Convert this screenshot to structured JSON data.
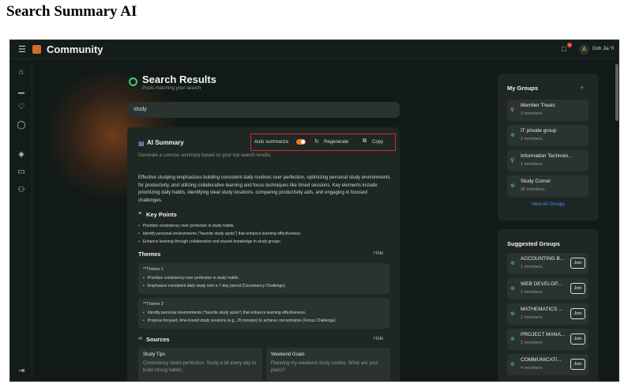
{
  "page_heading": "Search Summary AI",
  "header": {
    "brand": "Community",
    "notifications_count": "1",
    "user_name": "Goh Jia Yi",
    "user_initial": "A"
  },
  "search": {
    "title": "Search Results",
    "subtitle": "Posts matching your search",
    "query": "study"
  },
  "ai_summary": {
    "title": "AI Summary",
    "description": "Generate a concise summary based on your top search results.",
    "auto_summarize_label": "Auto summarize",
    "auto_summarize_on": true,
    "regenerate_label": "Regenerate",
    "copy_label": "Copy",
    "summary": "Effective studying emphasizes building consistent daily routines over perfection, optimizing personal study environments for productivity, and utilizing collaborative learning and focus techniques like timed sessions. Key elements include prioritizing daily habits, identifying ideal study locations, comparing productivity aids, and engaging in focused challenges.",
    "key_points_title": "Key Points",
    "key_points": [
      "Prioritize consistency over perfection in study habits.",
      "Identify personal environments (\"favorite study spots\") that enhance learning effectiveness.",
      "Enhance learning through collaboration and shared knowledge in study groups."
    ],
    "themes_title": "Themes",
    "themes_hide": "Hide",
    "themes": [
      {
        "name": "**Theme 1",
        "items": [
          "Prioritize consistency over perfection in study habits.",
          "Emphasize consistent daily study over a 7-day period (Consistency Challenge)."
        ]
      },
      {
        "name": "**Theme 2",
        "items": [
          "Identify personal environments (\"favorite study spots\") that enhance learning effectiveness.",
          "Propose focused, time-bound study sessions (e.g., 25 minutes) to achieve concentration (Focus Challenge)."
        ]
      }
    ],
    "sources_title": "Sources",
    "sources_hide": "Hide",
    "sources": [
      {
        "title": "Study Tips",
        "text": "Consistency beats perfection. Study a bit every day to build strong habits."
      },
      {
        "title": "Weekend Goals",
        "text": "Planning my weekend study routine. What are your plans?"
      }
    ]
  },
  "my_groups": {
    "title": "My Groups",
    "add": "+",
    "groups": [
      {
        "name": "Member Treats",
        "members": "3 members",
        "icon": "lock-icon",
        "icon_glyph": "🔒",
        "color": "#e7b54d"
      },
      {
        "name": "IT private group",
        "members": "2 members",
        "icon": "globe-icon",
        "icon_glyph": "⊕",
        "color": "#3ecf7a"
      },
      {
        "name": "Information Technolo...",
        "members": "1 members",
        "icon": "lock-icon",
        "icon_glyph": "🔒",
        "color": "#e7b54d"
      },
      {
        "name": "Study Corner",
        "members": "26 members",
        "icon": "globe-icon",
        "icon_glyph": "⊕",
        "color": "#3ecf7a"
      }
    ],
    "view_all": "View All Groups"
  },
  "suggested_groups": {
    "title": "Suggested Groups",
    "join_label": "Join",
    "groups": [
      {
        "name": "ACCOUNTING B...",
        "members": "1 members"
      },
      {
        "name": "WEB DEVELOP...",
        "members": "2 members"
      },
      {
        "name": "MATHEMATICS ...",
        "members": "2 members"
      },
      {
        "name": "PROJECT MANA...",
        "members": "2 members"
      },
      {
        "name": "COMMUNICATI...",
        "members": "4 members"
      }
    ]
  },
  "sidebar": {
    "icons": [
      "home-icon",
      "chart-icon",
      "bell-icon",
      "chat-icon",
      "graduation-cap-icon",
      "monitor-icon",
      "users-icon",
      "logout-icon"
    ]
  },
  "colors": {
    "accent_orange": "#e8792c",
    "accent_green": "#3ecf7a",
    "accent_blue": "#4f8ef7",
    "highlight_red": "#d32a2a"
  }
}
